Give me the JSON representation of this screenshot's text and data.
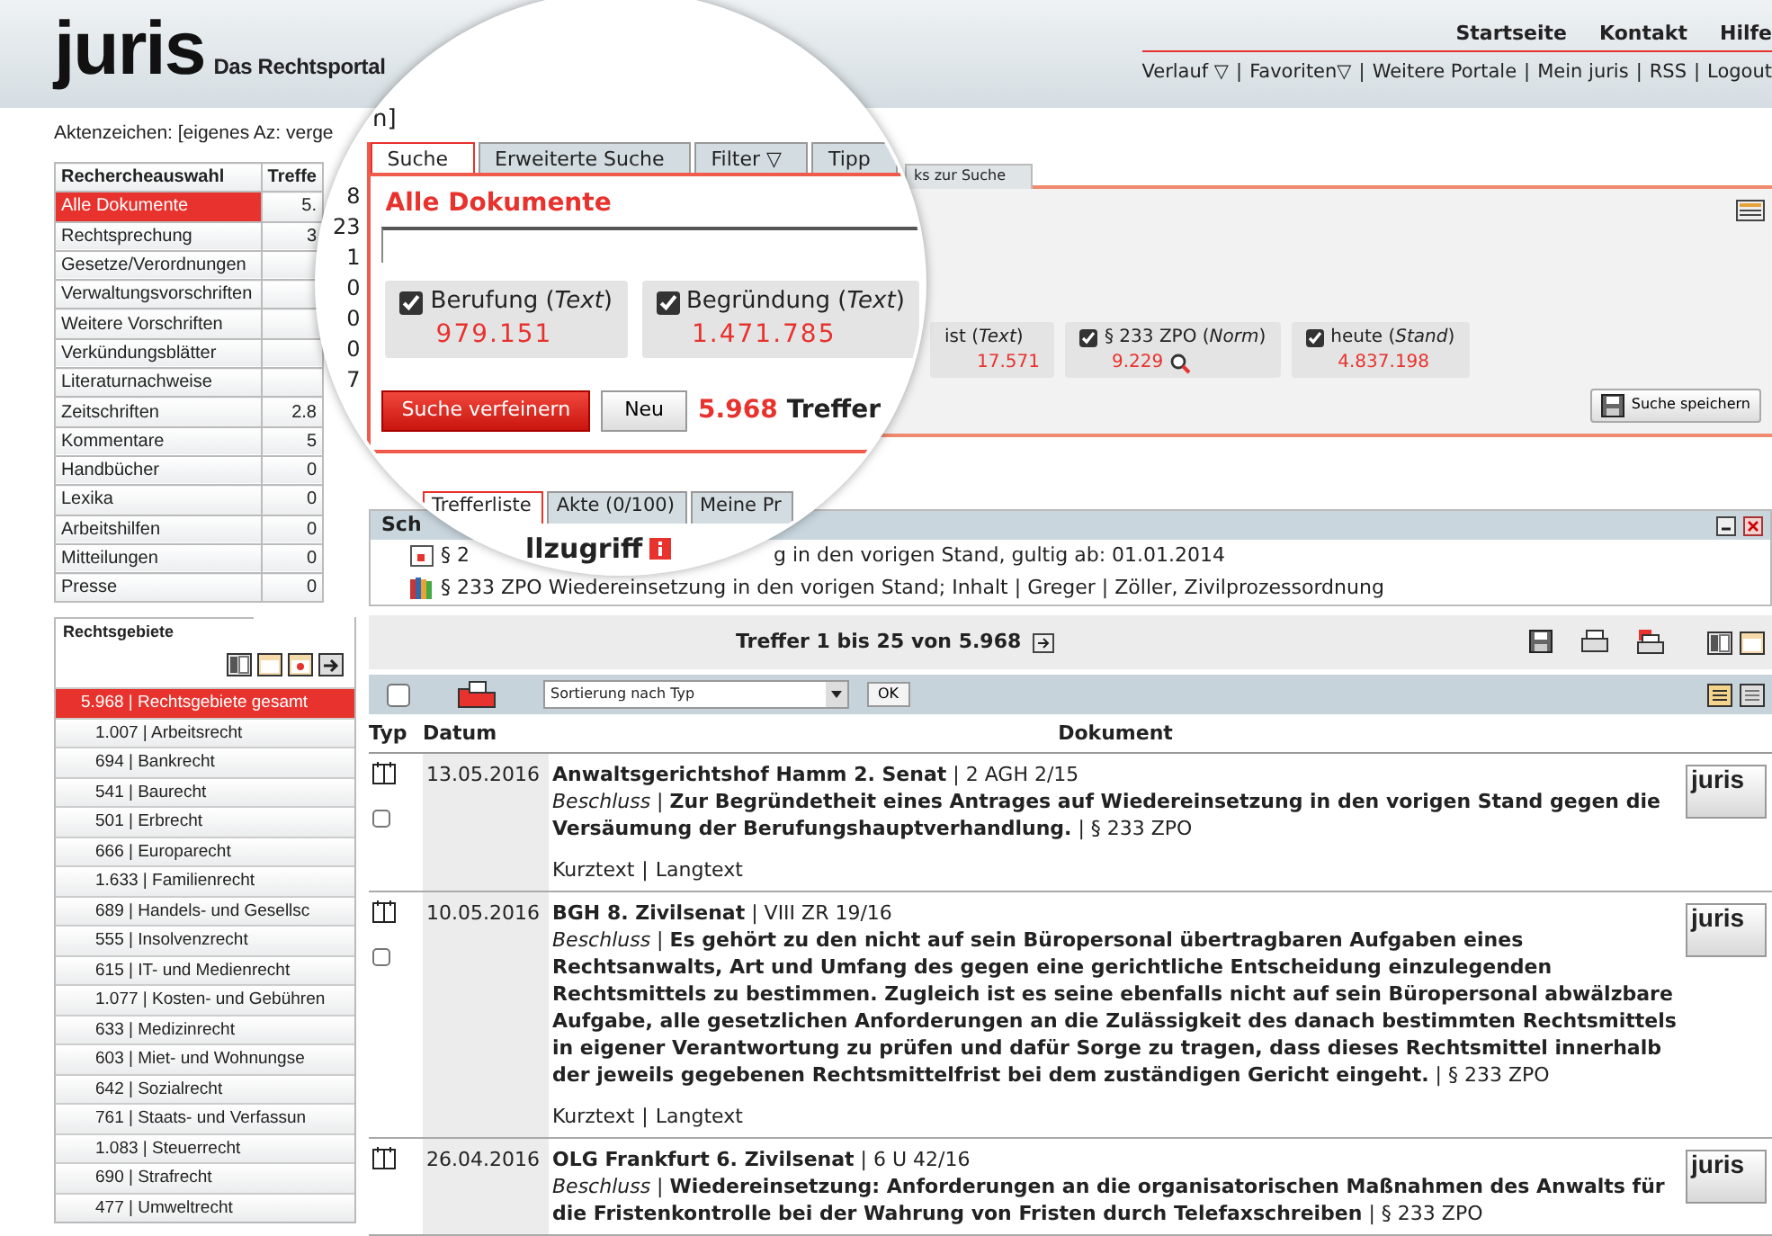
{
  "header": {
    "logo": "juris",
    "tagline": "Das Rechtsportal",
    "top_links": [
      "Startseite",
      "Kontakt",
      "Hilfe"
    ],
    "sub_links": [
      "Verlauf ▽",
      "Favoriten▽",
      "Weitere Portale",
      "Mein juris",
      "RSS",
      "Logout"
    ],
    "separator": "|"
  },
  "case_reference": "Aktenzeichen: [eigenes Az: verge",
  "research_selection": {
    "columns": [
      "Rechercheauswahl",
      "Treffe"
    ],
    "rows": [
      {
        "name": "Alle Dokumente",
        "count": "5.",
        "selected": true
      },
      {
        "name": "Rechtsprechung",
        "count": "3",
        "selected": false
      },
      {
        "name": "Gesetze/Verordnungen",
        "selected": false
      },
      {
        "name": "Verwaltungsvorschriften",
        "selected": false
      },
      {
        "name": "Weitere Vorschriften",
        "selected": false
      },
      {
        "name": "Verkündungsblätter",
        "selected": false
      },
      {
        "name": "Literaturnachweise",
        "selected": false
      },
      {
        "name": "Zeitschriften",
        "count": "2.8",
        "selected": false
      },
      {
        "name": "Kommentare",
        "count": "5",
        "selected": false
      },
      {
        "name": "Handbücher",
        "count": "0",
        "selected": false
      },
      {
        "name": "Lexika",
        "count": "0",
        "selected": false
      },
      {
        "name": "Arbeitshilfen",
        "count": "0",
        "selected": false
      },
      {
        "name": "Mitteilungen",
        "count": "0",
        "selected": false
      },
      {
        "name": "Presse",
        "count": "0",
        "selected": false
      }
    ]
  },
  "legal_areas": {
    "title": "Rechtsgebiete",
    "items": [
      {
        "label": "5.968 | Rechtsgebiete gesamt",
        "selected": true
      },
      {
        "label": "1.007 | Arbeitsrecht",
        "selected": false
      },
      {
        "label": "694 | Bankrecht",
        "selected": false
      },
      {
        "label": "541 | Baurecht",
        "selected": false
      },
      {
        "label": "501 | Erbrecht",
        "selected": false
      },
      {
        "label": "666 | Europarecht",
        "selected": false
      },
      {
        "label": "1.633 | Familienrecht",
        "selected": false
      },
      {
        "label": "689 | Handels- und Gesellsc",
        "selected": false
      },
      {
        "label": "555 | Insolvenzrecht",
        "selected": false
      },
      {
        "label": "615 | IT- und Medienrecht",
        "selected": false
      },
      {
        "label": "1.077 | Kosten- und Gebühren",
        "selected": false
      },
      {
        "label": "633 | Medizinrecht",
        "selected": false
      },
      {
        "label": "603 | Miet- und Wohnungse",
        "selected": false
      },
      {
        "label": "642 | Sozialrecht",
        "selected": false
      },
      {
        "label": "761 | Staats- und Verfassun",
        "selected": false
      },
      {
        "label": "1.083 | Steuerrecht",
        "selected": false
      },
      {
        "label": "690 | Strafrecht",
        "selected": false
      },
      {
        "label": "477 | Umweltrecht",
        "selected": false
      }
    ]
  },
  "search_panel": {
    "tab_fragment": "ks zur Suche",
    "criteria": [
      {
        "kind": "text",
        "label": "ist (*Text*)",
        "count": "17.571"
      },
      {
        "kind": "norm",
        "label": "§ 233 ZPO (*Norm*)",
        "checked": true,
        "count": "9.229"
      },
      {
        "kind": "date",
        "label": "heute (*Stand*)",
        "checked": true,
        "count": "4.837.198"
      }
    ],
    "save_button": "Suche speichern"
  },
  "magnifier": {
    "breadcrumb_fragment": "n]",
    "count_fragments": [
      "8",
      "23",
      "1",
      "0",
      "0",
      "0",
      "7"
    ],
    "search_tabs": [
      {
        "label": "Suche",
        "selected": true
      },
      {
        "label": "Erweiterte Suche",
        "selected": false
      },
      {
        "label": "Filter ▽",
        "selected": false
      },
      {
        "label": "Tipp",
        "selected": false
      }
    ],
    "heading": "Alle Dokumente",
    "criteria": [
      {
        "label": "Berufung (*Text*)",
        "checked": true,
        "count": "979.151"
      },
      {
        "label": "Begründung (*Text*)",
        "checked": true,
        "count": "1.471.785"
      }
    ],
    "refine_button": "Suche verfeinern",
    "new_button": "Neu",
    "hit_count": "5.968",
    "hit_label": "Treffer",
    "result_tabs": [
      {
        "label": "Trefferliste",
        "selected": true
      },
      {
        "label": "Akte (0/100)",
        "selected": false
      },
      {
        "label": "Meine Pr",
        "selected": false
      }
    ],
    "quick_access_title": "llzugriff"
  },
  "quick_access": {
    "header": "Sch",
    "lines": [
      {
        "kind": "norm",
        "prefix": "§ 2",
        "text": "g in den vorigen Stand, gultig ab: 01.01.2014"
      },
      {
        "kind": "commentary",
        "text": "§ 233 ZPO Wiedereinsetzung in den vorigen Stand; Inhalt | Greger | Zöller, Zivilprozessordnung"
      }
    ]
  },
  "pager": {
    "text": "Treffer 1 bis 25 von 5.968"
  },
  "toolbar": {
    "select_all_checked": false,
    "sort": "Sortierung nach Typ",
    "ok": "OK"
  },
  "results": {
    "columns": [
      "Typ",
      "Datum",
      "Dokument"
    ],
    "rows": [
      {
        "date": "13.05.2016",
        "court": "**Anwaltsgerichtshof Hamm 2. Senat** | 2 AGH 2/15",
        "summary": "*Beschluss* | **Zur Begründetheit eines Antrages auf Wiedereinsetzung in den vorigen Stand gegen die Versäumung der Berufungshauptverhandlung.** | § 233 ZPO",
        "links": [
          "Kurztext",
          "Langtext"
        ],
        "checked": false,
        "source": "juris"
      },
      {
        "date": "10.05.2016",
        "court": "**BGH 8. Zivilsenat** | VIII ZR 19/16",
        "summary": "*Beschluss* | **Es gehört zu den nicht auf sein Büropersonal übertragbaren Aufgaben eines Rechtsanwalts, Art und Umfang des gegen eine gerichtliche Entscheidung einzulegenden Rechtsmittels zu bestimmen. Zugleich ist es seine ebenfalls nicht auf sein Büropersonal abwälzbare Aufgabe, alle gesetzlichen Anforderungen an die Zulässigkeit des danach bestimmten Rechtsmittels in eigener Verantwortung zu prüfen und dafür Sorge zu tragen, dass dieses Rechtsmittel innerhalb der jeweils gegebenen Rechtsmittelfrist bei dem zuständigen Gericht eingeht.** | § 233 ZPO",
        "links": [
          "Kurztext",
          "Langtext"
        ],
        "checked": false,
        "source": "juris"
      },
      {
        "date": "26.04.2016",
        "court": "**OLG Frankfurt 6. Zivilsenat** | 6 U 42/16",
        "summary": "*Beschluss* | **Wiedereinsetzung: Anforderungen an die organisatorischen Maßnahmen des Anwalts für die Fristenkontrolle bei der Wahrung von Fristen durch Telefaxschreiben** | § 233 ZPO",
        "source": "juris"
      }
    ]
  }
}
